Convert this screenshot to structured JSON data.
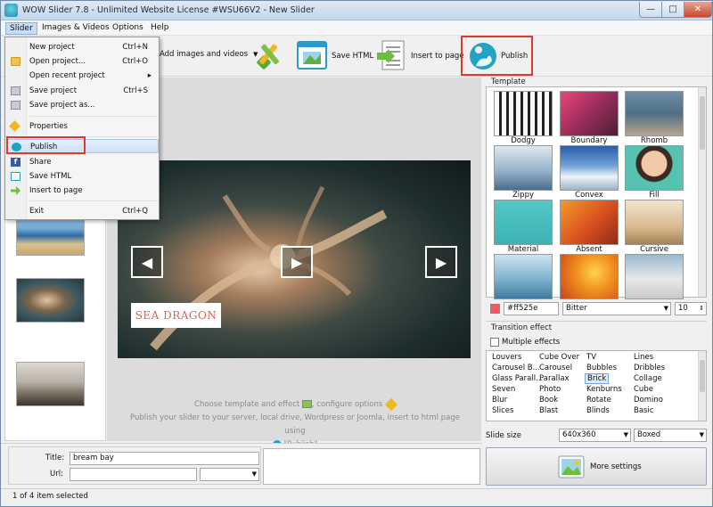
{
  "window": {
    "title": "WOW Slider 7.8 - Unlimited Website License #WSU66V2 - New Slider",
    "minimize": "—",
    "maximize": "□",
    "close": "✕"
  },
  "menubar": {
    "items": [
      "Slider",
      "Images & Videos",
      "Options",
      "Help"
    ]
  },
  "toolbar": {
    "add_images": "Add images and videos",
    "save_html": "Save HTML",
    "insert_to_page": "Insert to page",
    "publish": "Publish"
  },
  "dropdown": {
    "items": [
      {
        "label": "New project",
        "shortcut": "Ctrl+N"
      },
      {
        "label": "Open project...",
        "shortcut": "Ctrl+O"
      },
      {
        "label": "Open recent project",
        "shortcut": "▸"
      },
      {
        "label": "Save project",
        "shortcut": "Ctrl+S"
      },
      {
        "label": "Save project as...",
        "shortcut": ""
      },
      {
        "label": "Properties",
        "shortcut": ""
      },
      {
        "label": "Publish",
        "shortcut": ""
      },
      {
        "label": "Share",
        "shortcut": ""
      },
      {
        "label": "Save HTML",
        "shortcut": ""
      },
      {
        "label": "Insert to page",
        "shortcut": ""
      },
      {
        "label": "Exit",
        "shortcut": "Ctrl+Q"
      }
    ]
  },
  "preview": {
    "caption": "SEA DRAGON",
    "prev_arrow": "◀",
    "play_button": "▶",
    "next_arrow": "▶",
    "hint_line1a": "Choose template and effect",
    "hint_line1b": ", configure options",
    "hint_line2": "Publish your slider to your server, local drive, Wordpress or Joomla, insert to html page using",
    "hint_line3": "\"Publish\""
  },
  "template_panel": {
    "title": "Template",
    "templates": [
      "Dodgy",
      "Boundary",
      "Rhomb",
      "Zippy",
      "Convex",
      "Fill",
      "Material",
      "Absent",
      "Cursive"
    ],
    "color_value": "#ff525e",
    "swatch_color": "#ff525e",
    "font_value": "Bitter",
    "font_size": "10"
  },
  "transition_panel": {
    "title": "Transition effect",
    "multiple_effects": "Multiple effects",
    "effects": [
      [
        "Louvers",
        "Cube Over",
        "TV",
        "Lines"
      ],
      [
        "Carousel B...",
        "Carousel",
        "Bubbles",
        "Dribbles"
      ],
      [
        "Glass Parall...",
        "Parallax",
        "Brick",
        "Collage"
      ],
      [
        "Seven",
        "Photo",
        "Kenburns",
        "Cube"
      ],
      [
        "Blur",
        "Book",
        "Rotate",
        "Domino"
      ],
      [
        "Slices",
        "Blast",
        "Blinds",
        "Basic"
      ]
    ],
    "selected_effect": "Brick"
  },
  "slide_settings": {
    "size_label": "Slide size",
    "size_value": "640x360",
    "mode_value": "Boxed",
    "more_settings": "More settings"
  },
  "item_props": {
    "title_label": "Title:",
    "title_value": "bream bay",
    "url_label": "Url:",
    "url_value": ""
  },
  "status": {
    "text": "1 of 4 item selected"
  }
}
